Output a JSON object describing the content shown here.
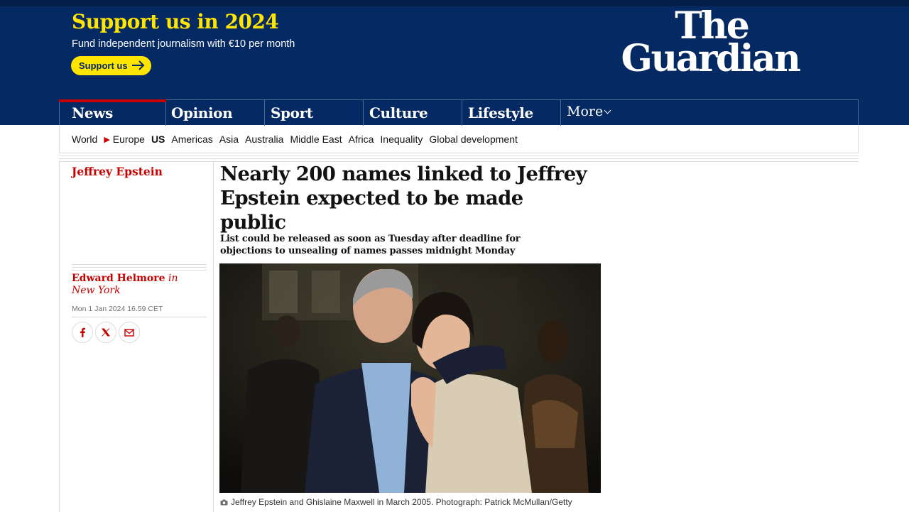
{
  "support": {
    "title": "Support us in 2024",
    "subtitle": "Fund independent journalism with €10 per month",
    "button_label": "Support us"
  },
  "logo": {
    "line1": "The",
    "line2": "Guardian"
  },
  "nav": {
    "pillars": [
      {
        "label": "News"
      },
      {
        "label": "Opinion"
      },
      {
        "label": "Sport"
      },
      {
        "label": "Culture"
      },
      {
        "label": "Lifestyle"
      }
    ],
    "more_label": "More"
  },
  "subnav": {
    "items": [
      "World",
      "Europe",
      "US",
      "Americas",
      "Asia",
      "Australia",
      "Middle East",
      "Africa",
      "Inequality",
      "Global development"
    ]
  },
  "article": {
    "series": "Jeffrey Epstein",
    "headline": "Nearly 200 names linked to Jeffrey Epstein expected to be made public",
    "standfirst": "List could be released as soon as Tuesday after deadline for objections to unsealing of names passes midnight Monday",
    "author": "Edward Helmore",
    "location": "in New York",
    "date": "Mon 1 Jan 2024 16.59 CET",
    "caption": "Jeffrey Epstein and Ghislaine Maxwell in March 2005. Photograph: Patrick McMullan/Getty"
  },
  "colors": {
    "brand": "#052962",
    "support_yellow": "#ffe500",
    "news_red": "#c70000"
  }
}
